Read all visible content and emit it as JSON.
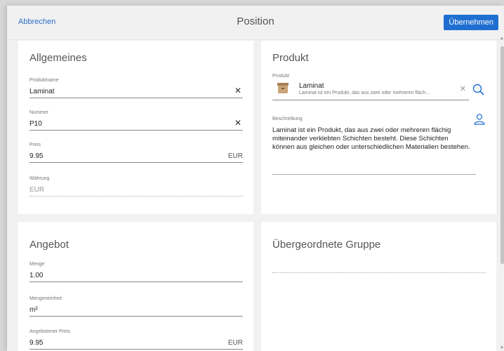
{
  "header": {
    "cancel_label": "Abbrechen",
    "title": "Position",
    "apply_label": "Übernehmen"
  },
  "general": {
    "title": "Allgemeines",
    "product_name": {
      "label": "Produktname",
      "value": "Laminat"
    },
    "number": {
      "label": "Nummer",
      "value": "P10"
    },
    "price": {
      "label": "Preis",
      "value": "9.95",
      "unit": "EUR"
    },
    "currency": {
      "label": "Währung",
      "value": "EUR"
    }
  },
  "product": {
    "title": "Produkt",
    "field_label": "Produkt",
    "name": "Laminat",
    "subtitle": "Laminat ist ein Produkt, das aus zwei oder mehreren fläch...",
    "description_label": "Beschreibung",
    "description": "Laminat ist ein Produkt, das aus zwei oder mehreren flächig miteinander verklebten Schichten besteht. Diese Schichten können aus gleichen oder unterschiedlichen Materialien bestehen."
  },
  "offer": {
    "title": "Angebot",
    "quantity": {
      "label": "Menge",
      "value": "1.00"
    },
    "unit": {
      "label": "Mengeneinheit",
      "value": "m²"
    },
    "offered_price": {
      "label": "Angebotener Preis",
      "value": "9.95",
      "unit": "EUR"
    }
  },
  "parent_group": {
    "title": "Übergeordnete Gruppe"
  },
  "icons": {
    "clear": "close-icon",
    "search": "search-icon",
    "person": "person-icon",
    "product": "box-icon"
  },
  "colors": {
    "accent": "#1f6fd1",
    "link": "#2b6cc4"
  }
}
